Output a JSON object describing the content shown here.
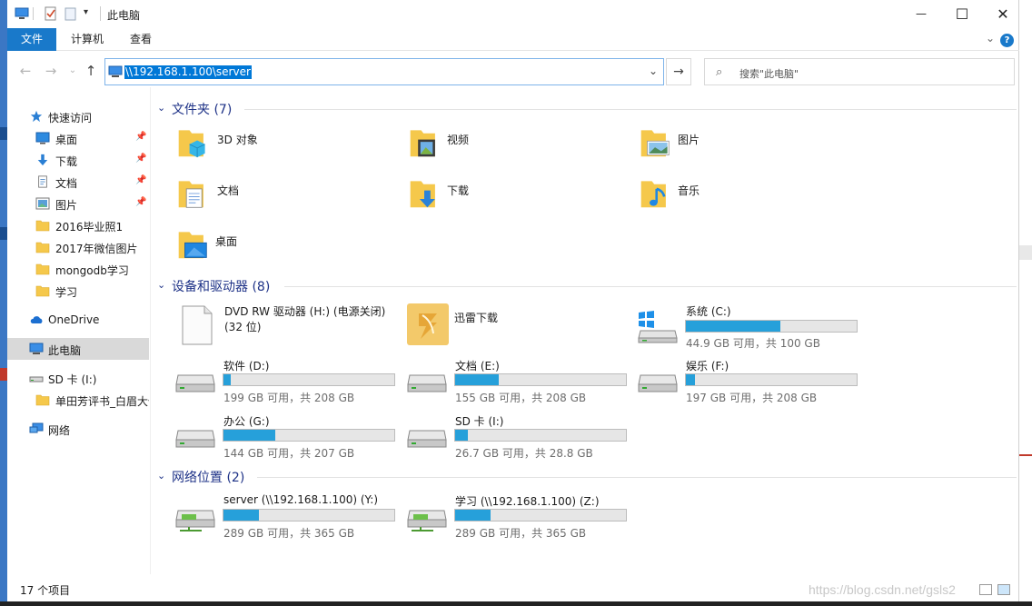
{
  "window": {
    "title": "此电脑",
    "minimize": "—",
    "maximize": "☐",
    "close": "✕"
  },
  "ribbon": {
    "tabs": [
      "文件",
      "计算机",
      "查看"
    ],
    "help": "?"
  },
  "address": {
    "path": "\\\\192.168.1.100\\server",
    "search_placeholder": "搜索\"此电脑\""
  },
  "sidebar": {
    "items": [
      {
        "label": "快速访问",
        "icon": "star-icon",
        "pinned": false
      },
      {
        "label": "桌面",
        "icon": "desktop-icon",
        "pinned": true
      },
      {
        "label": "下载",
        "icon": "download-icon",
        "pinned": true
      },
      {
        "label": "文档",
        "icon": "document-icon",
        "pinned": true
      },
      {
        "label": "图片",
        "icon": "pictures-icon",
        "pinned": true
      },
      {
        "label": "2016毕业照1",
        "icon": "folder-icon",
        "pinned": false
      },
      {
        "label": "2017年微信图片",
        "icon": "folder-icon",
        "pinned": false
      },
      {
        "label": "mongodb学习",
        "icon": "folder-icon",
        "pinned": false
      },
      {
        "label": "学习",
        "icon": "folder-icon",
        "pinned": false
      },
      {
        "label": "OneDrive",
        "icon": "cloud-icon",
        "pinned": false
      },
      {
        "label": "此电脑",
        "icon": "computer-icon",
        "pinned": false,
        "selected": true
      },
      {
        "label": "SD 卡 (I:)",
        "icon": "sd-card-icon",
        "pinned": false
      },
      {
        "label": "单田芳评书_白眉大侠",
        "icon": "folder-icon",
        "pinned": false
      },
      {
        "label": "网络",
        "icon": "network-icon",
        "pinned": false
      }
    ]
  },
  "groups": {
    "folders": {
      "title": "文件夹 (7)",
      "items": [
        {
          "label": "3D 对象",
          "icon": "3d-objects-folder-icon"
        },
        {
          "label": "视频",
          "icon": "videos-folder-icon"
        },
        {
          "label": "图片",
          "icon": "pictures-folder-icon"
        },
        {
          "label": "文档",
          "icon": "documents-folder-icon"
        },
        {
          "label": "下载",
          "icon": "downloads-folder-icon"
        },
        {
          "label": "音乐",
          "icon": "music-folder-icon"
        },
        {
          "label": "桌面",
          "icon": "desktop-folder-icon"
        }
      ]
    },
    "drives": {
      "title": "设备和驱动器 (8)",
      "items": [
        {
          "label": "DVD RW 驱动器 (H:) (电源关闭)",
          "sub": "(32 位)",
          "icon": "dvd-drive-icon"
        },
        {
          "label": "迅雷下载",
          "icon": "xunlei-icon"
        },
        {
          "label": "系统 (C:)",
          "sub": "44.9 GB 可用，共 100 GB",
          "used_fraction": 0.551,
          "icon": "system-drive-icon"
        },
        {
          "label": "软件 (D:)",
          "sub": "199 GB 可用，共 208 GB",
          "used_fraction": 0.043,
          "icon": "hard-drive-icon"
        },
        {
          "label": "文档 (E:)",
          "sub": "155 GB 可用，共 208 GB",
          "used_fraction": 0.255,
          "icon": "hard-drive-icon"
        },
        {
          "label": "娱乐 (F:)",
          "sub": "197 GB 可用，共 208 GB",
          "used_fraction": 0.053,
          "icon": "hard-drive-icon"
        },
        {
          "label": "办公 (G:)",
          "sub": "144 GB 可用，共 207 GB",
          "used_fraction": 0.304,
          "icon": "hard-drive-icon"
        },
        {
          "label": "SD 卡 (I:)",
          "sub": "26.7 GB 可用，共 28.8 GB",
          "used_fraction": 0.073,
          "icon": "hard-drive-icon"
        }
      ]
    },
    "network": {
      "title": "网络位置 (2)",
      "items": [
        {
          "label": "server (\\\\192.168.1.100) (Y:)",
          "sub": "289 GB 可用，共 365 GB",
          "used_fraction": 0.208,
          "icon": "network-drive-icon"
        },
        {
          "label": "学习 (\\\\192.168.1.100) (Z:)",
          "sub": "289 GB 可用，共 365 GB",
          "used_fraction": 0.208,
          "icon": "network-drive-icon"
        }
      ]
    }
  },
  "status": {
    "count": "17 个项目"
  },
  "watermark": "https://blog.csdn.net/gsls2"
}
